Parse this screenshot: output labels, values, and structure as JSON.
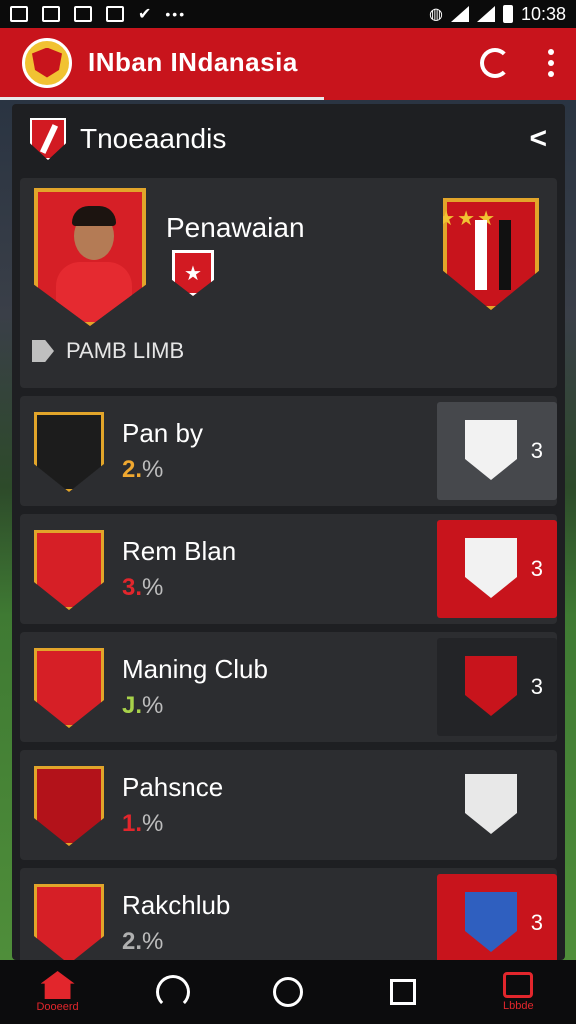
{
  "status_bar": {
    "time": "10:38",
    "dots": "•••"
  },
  "app_bar": {
    "title": "INban INdanasia"
  },
  "sub_header": {
    "title": "Tnoeaandis",
    "share_glyph": "<"
  },
  "featured": {
    "name": "Penawaian",
    "tag": "PAMB LIMB",
    "badge_glyph": "★"
  },
  "rows": [
    {
      "name": "Pan by",
      "pct_digit": "2.",
      "pct_sign": "%",
      "pct_color": "#f0a830",
      "count": "3",
      "shield_color": "#1c1c1c",
      "side_bg": "#46484c",
      "crest_color": "#f2f2f2"
    },
    {
      "name": "Rem Blan",
      "pct_digit": "3.",
      "pct_sign": "%",
      "pct_color": "#e2262c",
      "count": "3",
      "shield_color": "#d61f26",
      "side_bg": "#c8141c",
      "crest_color": "#f2f2f2"
    },
    {
      "name": "Maning Club",
      "pct_digit": "J.",
      "pct_sign": "%",
      "pct_color": "#a8d24a",
      "count": "3",
      "shield_color": "#d61f26",
      "side_bg": "#232427",
      "crest_color": "#c8141c"
    },
    {
      "name": "Pahsnce",
      "pct_digit": "1.",
      "pct_sign": "%",
      "pct_color": "#e2262c",
      "count": "",
      "shield_color": "#b3121a",
      "side_bg": "#2c2d30",
      "crest_color": "#e8e8e8"
    },
    {
      "name": "Rakchlub",
      "pct_digit": "2.",
      "pct_sign": "%",
      "pct_color": "#b0b0b0",
      "count": "3",
      "shield_color": "#d61f26",
      "side_bg": "#c8141c",
      "crest_color": "#2f5fbf"
    }
  ],
  "nav": {
    "home_label": "Dooeerd",
    "table_label": "Lbbde"
  },
  "colors": {
    "brand": "#c8141c",
    "gold": "#e2a52a"
  }
}
